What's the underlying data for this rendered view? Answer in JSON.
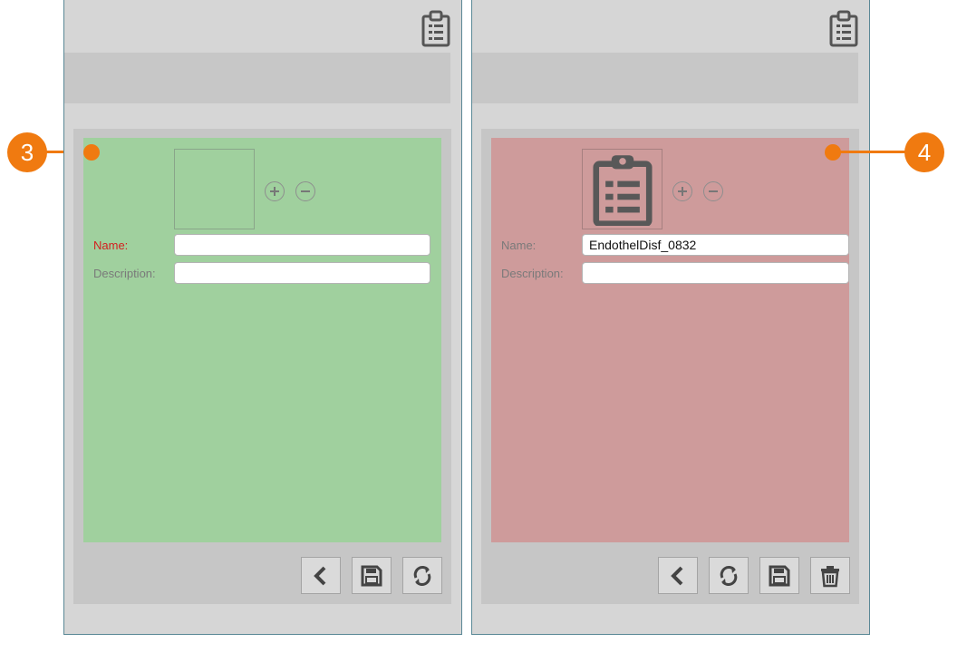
{
  "callouts": {
    "left": "3",
    "right": "4"
  },
  "icons": {
    "header": "clipboard-list-icon",
    "image": "clipboard-list-icon",
    "zoom_in": "plus-circle-icon",
    "zoom_out": "minus-circle-icon",
    "back": "chevron-left-icon",
    "save": "floppy-disk-icon",
    "refresh": "refresh-icon",
    "delete": "trash-icon"
  },
  "colors": {
    "panel_bg": "#d6d6d6",
    "band_bg": "#c7c7c7",
    "card_frame_bg": "#c6c6c6",
    "card_new_bg": "#a0d09e",
    "card_existing_bg": "#ce9b9b",
    "required_label": "#d32020",
    "callout": "#f07a10"
  },
  "left_panel": {
    "form": {
      "name_label": "Name:",
      "name_value": "",
      "description_label": "Description:",
      "description_value": ""
    },
    "actions": [
      "back",
      "save",
      "refresh"
    ]
  },
  "right_panel": {
    "form": {
      "name_label": "Name:",
      "name_value": "EndothelDisf_0832",
      "description_label": "Description:",
      "description_value": ""
    },
    "actions": [
      "back",
      "refresh",
      "save",
      "delete"
    ]
  }
}
